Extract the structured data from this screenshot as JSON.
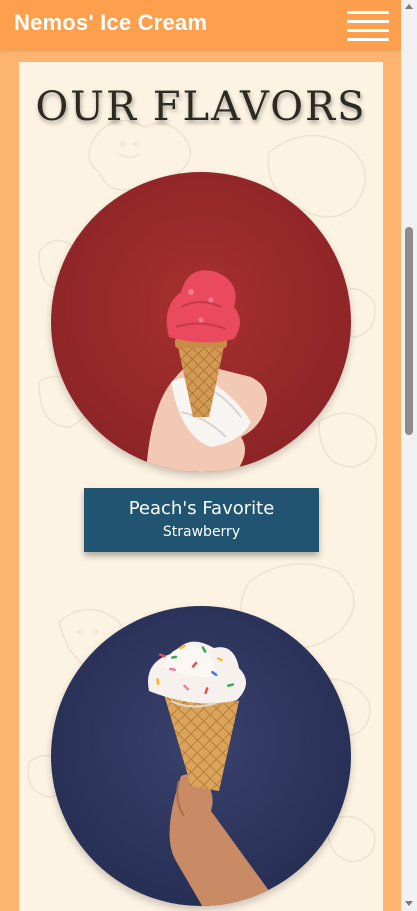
{
  "header": {
    "brand": "Nemos' Ice Cream",
    "menu_icon": "hamburger-menu-icon"
  },
  "main": {
    "title": "OUR FLAVORS",
    "flavors": [
      {
        "name": "Peach's Favorite",
        "type": "Strawberry",
        "photo": "strawberry-cone-photo",
        "background_color": "#9a2a2c"
      },
      {
        "photo": "vanilla-sprinkles-cone-photo",
        "background_color": "#2f3860"
      }
    ]
  },
  "colors": {
    "header": "#fe9f4e",
    "page_background": "#fdb46e",
    "content_background": "#fdf3e3",
    "card": "#205470"
  }
}
